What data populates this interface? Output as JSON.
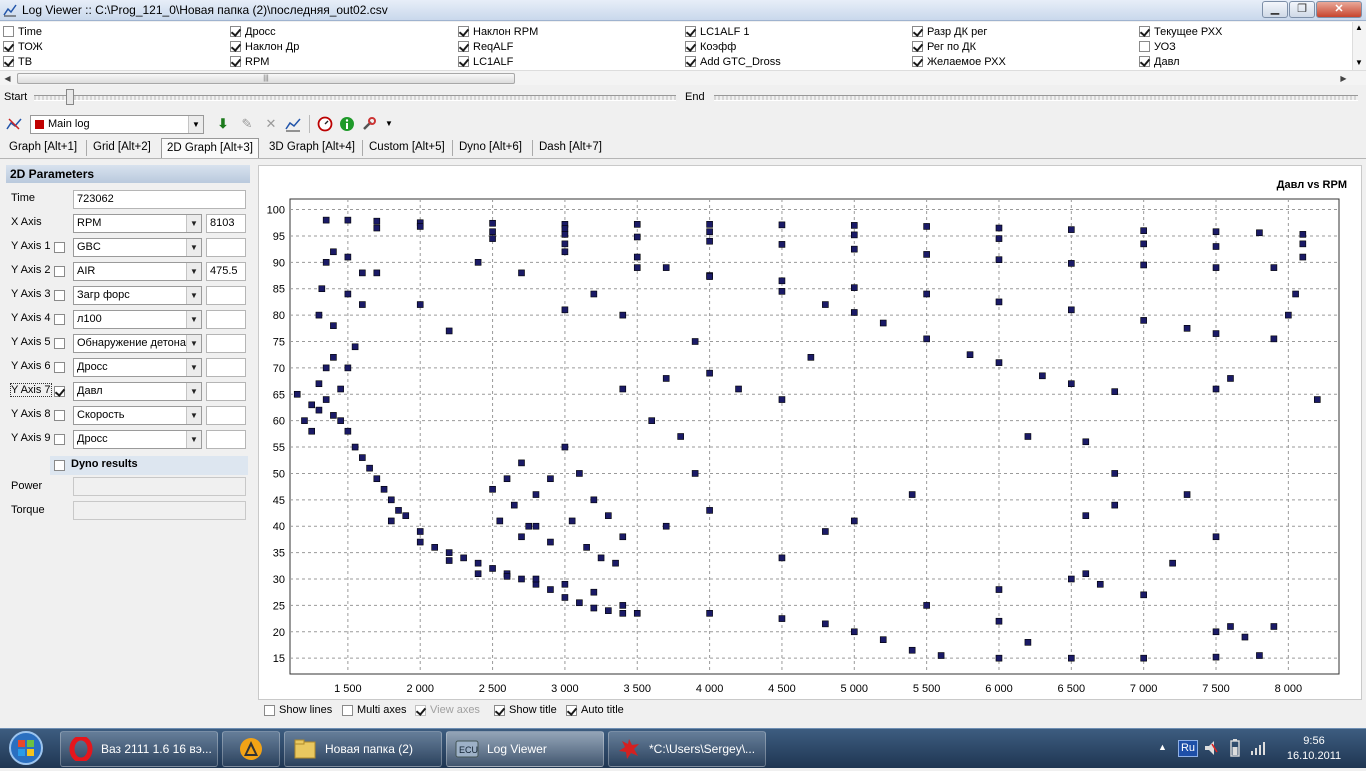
{
  "window": {
    "title": "Log Viewer :: C:\\Prog_121_0\\Новая папка (2)\\последняя_out02.csv",
    "min_label": "▁",
    "max_label": "❐",
    "close_label": "✕"
  },
  "channels": [
    {
      "label": "Time",
      "checked": false,
      "col": 0,
      "row": 0
    },
    {
      "label": "ТОЖ",
      "checked": true,
      "col": 0,
      "row": 1
    },
    {
      "label": "ТВ",
      "checked": true,
      "col": 0,
      "row": 2
    },
    {
      "label": "Дросс",
      "checked": true,
      "col": 1,
      "row": 0
    },
    {
      "label": "Наклон Др",
      "checked": true,
      "col": 1,
      "row": 1
    },
    {
      "label": "RPM",
      "checked": true,
      "col": 1,
      "row": 2
    },
    {
      "label": "Наклон RPM",
      "checked": true,
      "col": 2,
      "row": 0
    },
    {
      "label": "ReqALF",
      "checked": true,
      "col": 2,
      "row": 1
    },
    {
      "label": "LC1ALF",
      "checked": true,
      "col": 2,
      "row": 2
    },
    {
      "label": "LC1ALF 1",
      "checked": true,
      "col": 3,
      "row": 0
    },
    {
      "label": "Коэфф",
      "checked": true,
      "col": 3,
      "row": 1
    },
    {
      "label": "Add GTC_Dross",
      "checked": true,
      "col": 3,
      "row": 2
    },
    {
      "label": "Разр ДК рег",
      "checked": true,
      "col": 4,
      "row": 0
    },
    {
      "label": "Рег по ДК",
      "checked": true,
      "col": 4,
      "row": 1
    },
    {
      "label": "Желаемое РХХ",
      "checked": true,
      "col": 4,
      "row": 2
    },
    {
      "label": "Текущее РХХ",
      "checked": true,
      "col": 5,
      "row": 0
    },
    {
      "label": "УОЗ",
      "checked": false,
      "col": 5,
      "row": 1
    },
    {
      "label": "Давл",
      "checked": true,
      "col": 5,
      "row": 2
    }
  ],
  "range": {
    "start_label": "Start",
    "end_label": "End"
  },
  "toolbar": {
    "log_selected": "Main log"
  },
  "tabs": [
    {
      "label": "Graph [Alt+1]",
      "active": false
    },
    {
      "label": "Grid [Alt+2]",
      "active": false
    },
    {
      "label": "2D Graph [Alt+3]",
      "active": true
    },
    {
      "label": "3D Graph [Alt+4]",
      "active": false
    },
    {
      "label": "Custom [Alt+5]",
      "active": false
    },
    {
      "label": "Dyno [Alt+6]",
      "active": false
    },
    {
      "label": "Dash [Alt+7]",
      "active": false
    }
  ],
  "params": {
    "header": "2D Parameters",
    "time_label": "Time",
    "time_value": "723062",
    "xaxis_label": "X Axis",
    "xaxis_value": "RPM",
    "xaxis_num": "8103",
    "yaxes": [
      {
        "label": "Y Axis 1",
        "checked": false,
        "value": "GBC",
        "num": ""
      },
      {
        "label": "Y Axis 2",
        "checked": false,
        "value": "AIR",
        "num": "475.5"
      },
      {
        "label": "Y Axis 3",
        "checked": false,
        "value": "Загр форс",
        "num": ""
      },
      {
        "label": "Y Axis 4",
        "checked": false,
        "value": "л100",
        "num": ""
      },
      {
        "label": "Y Axis 5",
        "checked": false,
        "value": "Обнаружение детона",
        "num": ""
      },
      {
        "label": "Y Axis 6",
        "checked": false,
        "value": "Дросс",
        "num": ""
      },
      {
        "label": "Y Axis 7",
        "checked": true,
        "value": "Давл",
        "num": ""
      },
      {
        "label": "Y Axis 8",
        "checked": false,
        "value": "Скорость",
        "num": ""
      },
      {
        "label": "Y Axis 9",
        "checked": false,
        "value": "Дросс",
        "num": ""
      }
    ],
    "dyno_label": "Dyno results",
    "power_label": "Power",
    "torque_label": "Torque"
  },
  "chart_options": [
    {
      "label": "Show lines",
      "checked": false,
      "disabled": false
    },
    {
      "label": "Multi axes",
      "checked": false,
      "disabled": false
    },
    {
      "label": "View axes",
      "checked": true,
      "disabled": true
    },
    {
      "label": "Show title",
      "checked": true,
      "disabled": false
    },
    {
      "label": "Auto title",
      "checked": true,
      "disabled": false
    }
  ],
  "chart_data": {
    "type": "scatter",
    "title": "Давл vs RPM",
    "xlim": [
      1100,
      8350
    ],
    "ylim": [
      12,
      102
    ],
    "xticks": [
      1500,
      2000,
      2500,
      3000,
      3500,
      4000,
      4500,
      5000,
      5500,
      6000,
      6500,
      7000,
      7500,
      8000
    ],
    "xtick_labels": [
      "1 500",
      "2 000",
      "2 500",
      "3 000",
      "3 500",
      "4 000",
      "4 500",
      "5 000",
      "5 500",
      "6 000",
      "6 500",
      "7 000",
      "7 500",
      "8 000"
    ],
    "yticks": [
      15,
      20,
      25,
      30,
      35,
      40,
      45,
      50,
      55,
      60,
      65,
      70,
      75,
      80,
      85,
      90,
      95,
      100
    ],
    "grid": true,
    "marker_color": "#1a1a66",
    "series": [
      {
        "points": [
          [
            1350,
            98
          ],
          [
            1500,
            98
          ],
          [
            1700,
            97.8
          ],
          [
            2000,
            97.5
          ],
          [
            2500,
            97.4
          ],
          [
            3000,
            97.2
          ],
          [
            3500,
            97.2
          ],
          [
            4000,
            97.2
          ],
          [
            4500,
            97.1
          ],
          [
            5000,
            97
          ],
          [
            5500,
            96.8
          ],
          [
            6000,
            96.5
          ],
          [
            6500,
            96.2
          ],
          [
            7000,
            96
          ],
          [
            7500,
            95.8
          ],
          [
            7800,
            95.6
          ],
          [
            8100,
            95.3
          ],
          [
            2000,
            96.8
          ],
          [
            3000,
            96.4
          ],
          [
            4000,
            95.8
          ],
          [
            5000,
            95.2
          ],
          [
            6000,
            94.5
          ],
          [
            7000,
            93.5
          ],
          [
            7500,
            93
          ],
          [
            8100,
            93.5
          ],
          [
            1700,
            96.5
          ],
          [
            2500,
            95.8
          ],
          [
            3000,
            95.3
          ],
          [
            3500,
            94.8
          ],
          [
            4000,
            94
          ],
          [
            4500,
            93.4
          ],
          [
            5000,
            92.5
          ],
          [
            5500,
            91.5
          ],
          [
            6000,
            90.5
          ],
          [
            6500,
            89.8
          ],
          [
            7000,
            89.5
          ],
          [
            7500,
            89
          ],
          [
            7900,
            89
          ],
          [
            2500,
            94.5
          ],
          [
            3000,
            93.5
          ],
          [
            3500,
            91
          ],
          [
            3700,
            89
          ],
          [
            4000,
            87.5
          ],
          [
            4500,
            86.5
          ],
          [
            5000,
            85.2
          ],
          [
            5500,
            84
          ],
          [
            6000,
            82.5
          ],
          [
            6500,
            81
          ],
          [
            7000,
            79
          ],
          [
            7300,
            77.5
          ],
          [
            7500,
            76.5
          ],
          [
            7900,
            75.5
          ],
          [
            8050,
            84
          ],
          [
            3000,
            92
          ],
          [
            3500,
            89
          ],
          [
            4000,
            87.3
          ],
          [
            4500,
            84.5
          ],
          [
            4800,
            82
          ],
          [
            5000,
            80.5
          ],
          [
            5200,
            78.5
          ],
          [
            5500,
            75.5
          ],
          [
            5800,
            72.5
          ],
          [
            6000,
            71
          ],
          [
            6300,
            68.5
          ],
          [
            6500,
            67
          ],
          [
            6800,
            65.5
          ],
          [
            1250,
            63
          ],
          [
            1300,
            62
          ],
          [
            1350,
            64
          ],
          [
            1400,
            61
          ],
          [
            1450,
            60
          ],
          [
            1500,
            58
          ],
          [
            1550,
            55
          ],
          [
            1600,
            53
          ],
          [
            1650,
            51
          ],
          [
            1700,
            49
          ],
          [
            1750,
            47
          ],
          [
            1800,
            45
          ],
          [
            1850,
            43
          ],
          [
            1900,
            42
          ],
          [
            2000,
            39
          ],
          [
            2100,
            36
          ],
          [
            2200,
            35
          ],
          [
            2300,
            34
          ],
          [
            2400,
            33
          ],
          [
            2500,
            32
          ],
          [
            2600,
            31
          ],
          [
            2700,
            30
          ],
          [
            2800,
            29
          ],
          [
            2900,
            28
          ],
          [
            3000,
            26.5
          ],
          [
            3100,
            25.5
          ],
          [
            3200,
            24.5
          ],
          [
            3300,
            24
          ],
          [
            3400,
            23.5
          ],
          [
            3500,
            23.5
          ],
          [
            4000,
            23.5
          ],
          [
            4500,
            22.5
          ],
          [
            4800,
            21.5
          ],
          [
            5000,
            20
          ],
          [
            5200,
            18.5
          ],
          [
            5400,
            16.5
          ],
          [
            5600,
            15.5
          ],
          [
            6000,
            15
          ],
          [
            6500,
            15
          ],
          [
            7000,
            15
          ],
          [
            7500,
            15.2
          ],
          [
            7800,
            15.5
          ],
          [
            1800,
            41
          ],
          [
            2000,
            37
          ],
          [
            2200,
            33.5
          ],
          [
            2400,
            31
          ],
          [
            2600,
            30.5
          ],
          [
            2800,
            30
          ],
          [
            3000,
            29
          ],
          [
            3200,
            27.5
          ],
          [
            3400,
            25
          ],
          [
            2600,
            49
          ],
          [
            2700,
            52
          ],
          [
            2800,
            46
          ],
          [
            2900,
            49
          ],
          [
            3000,
            55
          ],
          [
            3100,
            50
          ],
          [
            3200,
            45
          ],
          [
            3300,
            42
          ],
          [
            3400,
            38
          ],
          [
            2500,
            47
          ],
          [
            2650,
            44
          ],
          [
            2750,
            40
          ],
          [
            2900,
            37
          ],
          [
            3050,
            41
          ],
          [
            3150,
            36
          ],
          [
            3250,
            34
          ],
          [
            3350,
            33
          ],
          [
            2550,
            41
          ],
          [
            2700,
            38
          ],
          [
            1300,
            67
          ],
          [
            1350,
            70
          ],
          [
            1400,
            72
          ],
          [
            1450,
            66
          ],
          [
            1500,
            70
          ],
          [
            1550,
            74
          ],
          [
            1400,
            78
          ],
          [
            1300,
            80
          ],
          [
            1320,
            85
          ],
          [
            1500,
            84
          ],
          [
            1600,
            82
          ],
          [
            1350,
            90
          ],
          [
            1400,
            92
          ],
          [
            1500,
            91
          ],
          [
            1600,
            88
          ],
          [
            1700,
            88
          ],
          [
            1150,
            65
          ],
          [
            1200,
            60
          ],
          [
            1250,
            58
          ],
          [
            2000,
            82
          ],
          [
            2200,
            77
          ],
          [
            2400,
            90
          ],
          [
            2700,
            88
          ],
          [
            3000,
            81
          ],
          [
            3200,
            84
          ],
          [
            3400,
            80
          ],
          [
            3700,
            68
          ],
          [
            4000,
            69
          ],
          [
            4200,
            66
          ],
          [
            4500,
            64
          ],
          [
            3900,
            75
          ],
          [
            3600,
            60
          ],
          [
            3800,
            57
          ],
          [
            3900,
            50
          ],
          [
            3700,
            40
          ],
          [
            4000,
            43
          ],
          [
            4500,
            34
          ],
          [
            4800,
            39
          ],
          [
            5000,
            41
          ],
          [
            5500,
            25
          ],
          [
            6000,
            28
          ],
          [
            6500,
            30
          ],
          [
            6600,
            31
          ],
          [
            6700,
            29
          ],
          [
            7000,
            27
          ],
          [
            7200,
            33
          ],
          [
            7300,
            46
          ],
          [
            7500,
            38
          ],
          [
            7600,
            21
          ],
          [
            7700,
            19
          ],
          [
            7900,
            21
          ],
          [
            7500,
            20
          ],
          [
            6000,
            22
          ],
          [
            6200,
            18
          ],
          [
            6800,
            44
          ],
          [
            7500,
            66
          ],
          [
            7600,
            68
          ],
          [
            8200,
            64
          ],
          [
            8000,
            80
          ],
          [
            8100,
            91
          ],
          [
            6600,
            56
          ],
          [
            6800,
            50
          ],
          [
            6600,
            42
          ],
          [
            3400,
            66
          ],
          [
            4700,
            72
          ],
          [
            2800,
            40
          ],
          [
            6200,
            57
          ],
          [
            5400,
            46
          ]
        ]
      }
    ]
  },
  "taskbar": {
    "items": [
      {
        "label": "Ваз 2111 1.6 16 вэ..."
      },
      {
        "label": ""
      },
      {
        "label": "Новая папка (2)"
      },
      {
        "label": "Log Viewer"
      },
      {
        "label": "*C:\\Users\\Sergey\\..."
      }
    ],
    "lang": "Ru",
    "time": "9:56",
    "date": "16.10.2011"
  }
}
